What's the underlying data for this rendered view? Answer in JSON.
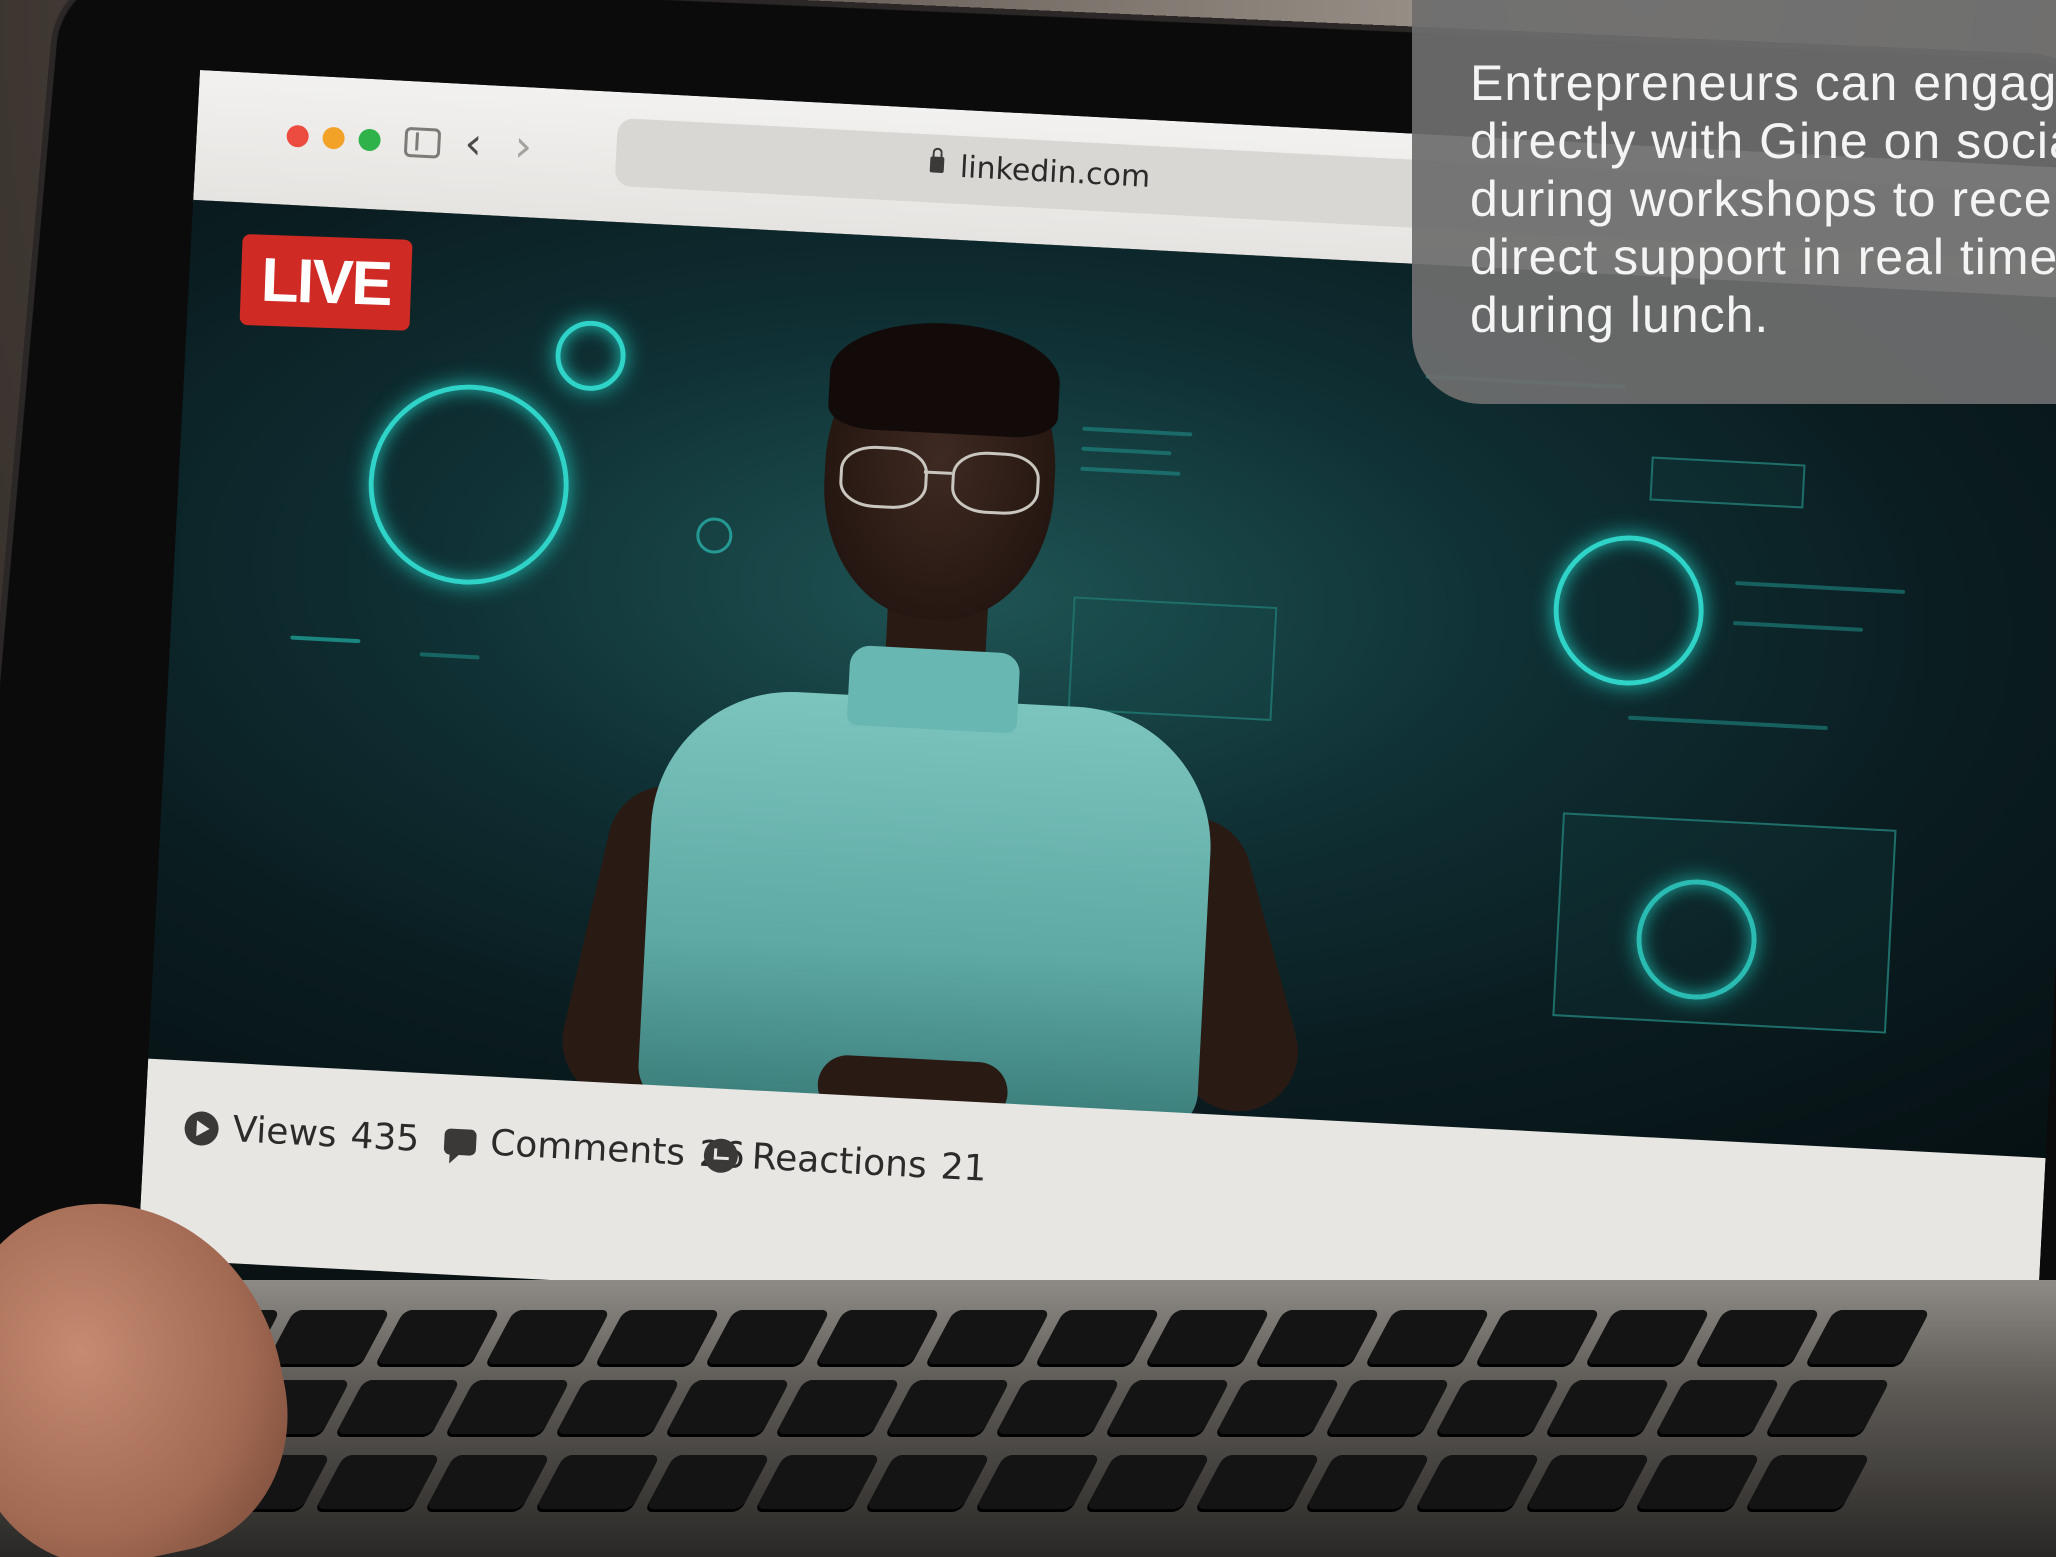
{
  "browser": {
    "url": "linkedin.com",
    "nav_back": "‹",
    "nav_forward": "›"
  },
  "video": {
    "live_badge": "LIVE"
  },
  "stats": {
    "views_label": "Views",
    "views_count": "435",
    "comments_label": "Comments",
    "comments_count": "26",
    "reactions_label": "Reactions",
    "reactions_count": "21",
    "more_label": "•••"
  },
  "caption": {
    "text": "Entrepreneurs can engag\ndirectly with Gine on socia\nduring workshops to rece\ndirect support in real time\nduring lunch."
  },
  "colors": {
    "live_red": "#cf2a24",
    "hud_teal": "#2fd3c8",
    "caption_bg": "#6e6e6e"
  },
  "icons": {
    "views": "play-icon",
    "comments": "comment-icon",
    "reactions": "reaction-icon",
    "lock": "lock-icon"
  }
}
